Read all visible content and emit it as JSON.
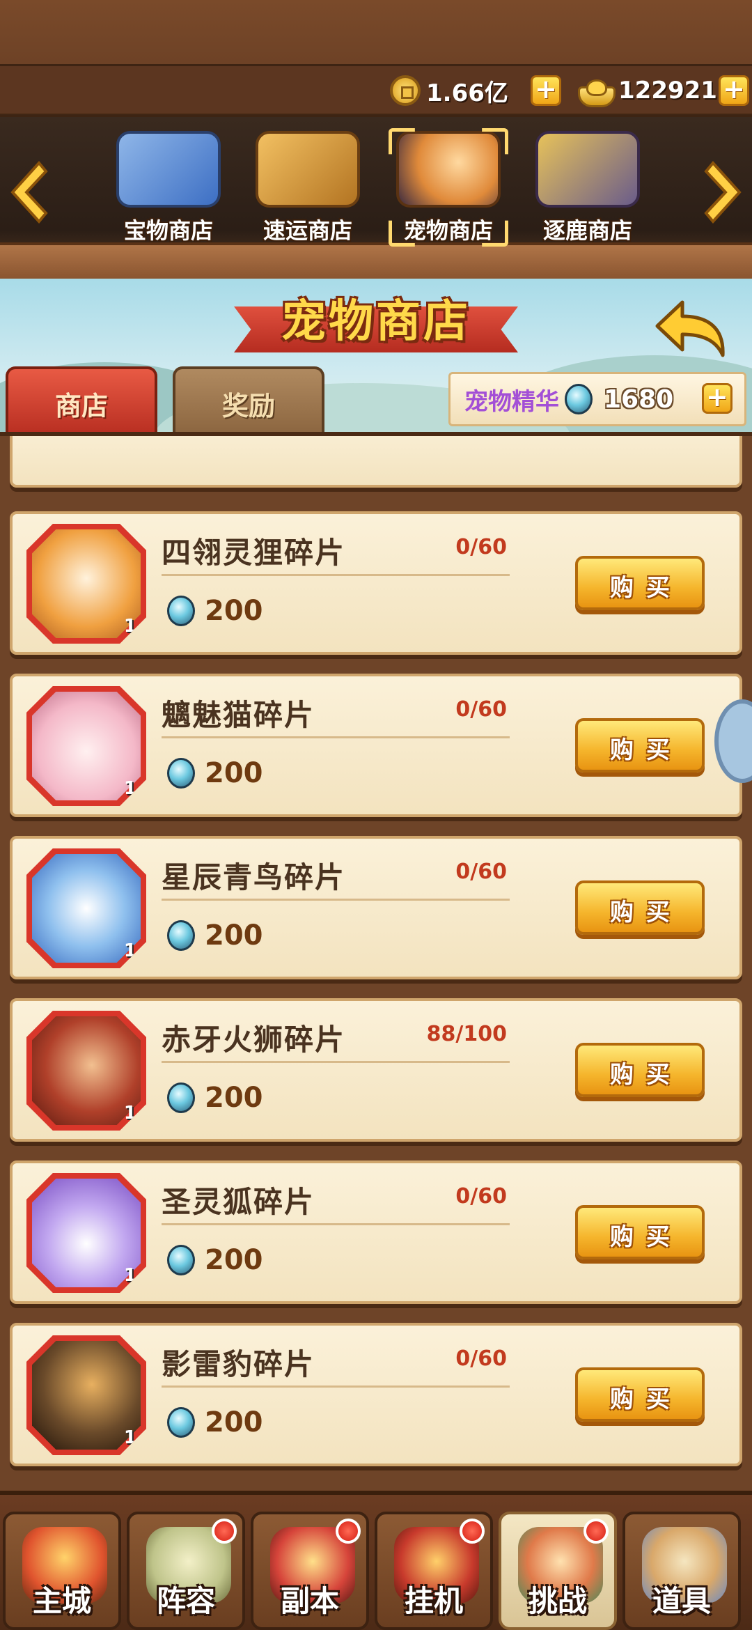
{
  "currency": {
    "copper": "1.66亿",
    "gold": "122921",
    "plus": "+"
  },
  "categories": [
    {
      "label": "宝物商店",
      "icon": "treasure-shop-icon"
    },
    {
      "label": "速运商店",
      "icon": "express-shop-icon"
    },
    {
      "label": "宠物商店",
      "icon": "pet-shop-icon",
      "selected": true
    },
    {
      "label": "逐鹿商店",
      "icon": "zhulu-shop-icon"
    }
  ],
  "banner": {
    "title": "宠物商店",
    "tabs": {
      "shop": "商店",
      "reward": "奖励"
    },
    "essence_label": "宠物精华",
    "essence_value": "1680"
  },
  "items": [
    {
      "name": "四翎灵狸碎片",
      "progress": "0/60",
      "price": "200",
      "count": "1",
      "icon": "spirit-fox-cat-avatar-icon",
      "color": "#f0a040"
    },
    {
      "name": "魑魅猫碎片",
      "progress": "0/60",
      "price": "200",
      "count": "1",
      "icon": "pink-hood-cat-avatar-icon",
      "color": "#f4b8c8"
    },
    {
      "name": "星辰青鸟碎片",
      "progress": "0/60",
      "price": "200",
      "count": "1",
      "icon": "blue-bird-avatar-icon",
      "color": "#5a8fd8"
    },
    {
      "name": "赤牙火狮碎片",
      "progress": "88/100",
      "price": "200",
      "count": "1",
      "icon": "red-fire-lion-avatar-icon",
      "color": "#b0402a"
    },
    {
      "name": "圣灵狐碎片",
      "progress": "0/60",
      "price": "200",
      "count": "1",
      "icon": "purple-fox-avatar-icon",
      "color": "#9d74d8"
    },
    {
      "name": "影雷豹碎片",
      "progress": "0/60",
      "price": "200",
      "count": "1",
      "icon": "shadow-leopard-avatar-icon",
      "color": "#5a3d26"
    }
  ],
  "buy_label": "购买",
  "nav": [
    {
      "label": "主城",
      "icon": "city-icon",
      "dot": false
    },
    {
      "label": "阵容",
      "icon": "lineup-icon",
      "dot": true
    },
    {
      "label": "副本",
      "icon": "dungeon-icon",
      "dot": true
    },
    {
      "label": "挂机",
      "icon": "idle-icon",
      "dot": true
    },
    {
      "label": "挑战",
      "icon": "challenge-icon",
      "dot": true,
      "active": true
    },
    {
      "label": "道具",
      "icon": "items-icon",
      "dot": false
    }
  ],
  "colors": {
    "accent_red": "#d9362a",
    "gold": "#f5b52c",
    "progress_red": "#c23a1e",
    "essence_purple": "#a34fd6"
  }
}
